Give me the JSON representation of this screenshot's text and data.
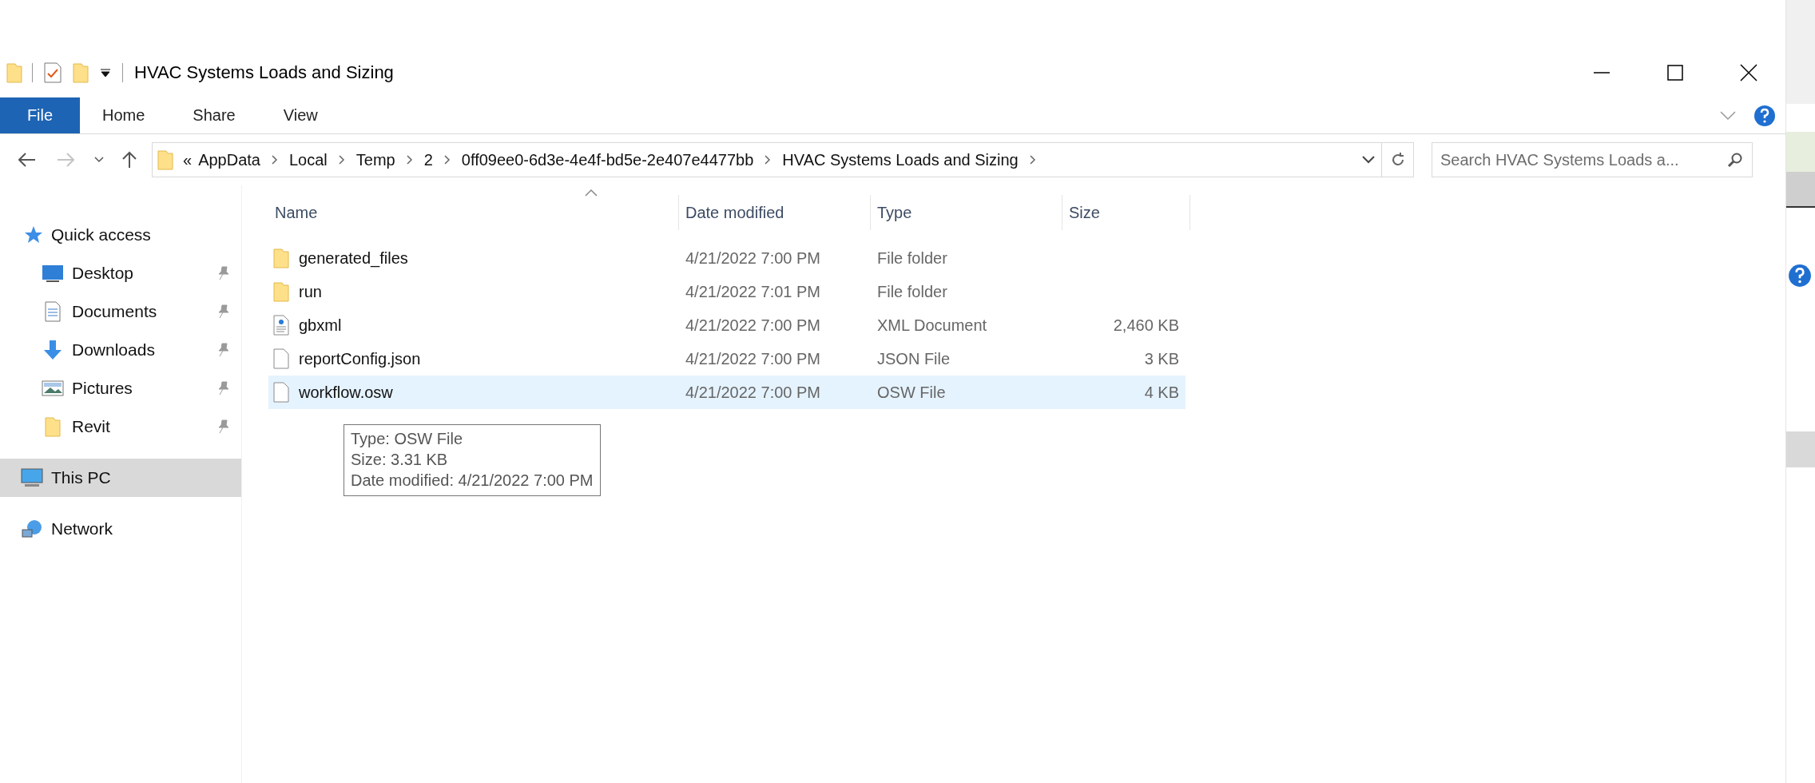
{
  "window": {
    "title": "HVAC Systems Loads and Sizing"
  },
  "ribbon_tabs": [
    {
      "label": "File",
      "kind": "file"
    },
    {
      "label": "Home",
      "kind": "tab"
    },
    {
      "label": "Share",
      "kind": "tab"
    },
    {
      "label": "View",
      "kind": "tab"
    }
  ],
  "address_bar": {
    "overflow": "«",
    "path": [
      "AppData",
      "Local",
      "Temp",
      "2",
      "0ff09ee0-6d3e-4e4f-bd5e-2e407e4477bb",
      "HVAC Systems Loads and Sizing"
    ]
  },
  "search": {
    "placeholder": "Search HVAC Systems Loads a..."
  },
  "sidebar": {
    "items": [
      {
        "label": "Quick access",
        "kind": "star",
        "selected": false,
        "children": [
          {
            "label": "Desktop",
            "kind": "desktop",
            "pinned": true,
            "selected": false
          },
          {
            "label": "Documents",
            "kind": "documents",
            "pinned": true,
            "selected": false
          },
          {
            "label": "Downloads",
            "kind": "downloads",
            "pinned": true,
            "selected": false
          },
          {
            "label": "Pictures",
            "kind": "pictures",
            "pinned": true,
            "selected": false
          },
          {
            "label": "Revit",
            "kind": "folder",
            "pinned": true,
            "selected": false
          }
        ]
      },
      {
        "label": "This PC",
        "kind": "computer",
        "selected": true
      },
      {
        "label": "Network",
        "kind": "network",
        "selected": false
      }
    ]
  },
  "table": {
    "columns": [
      {
        "label": "Name",
        "sorted": true
      },
      {
        "label": "Date modified",
        "sorted": false
      },
      {
        "label": "Type",
        "sorted": false
      },
      {
        "label": "Size",
        "sorted": false
      }
    ],
    "rows": [
      {
        "name": "generated_files",
        "date": "4/21/2022 7:00 PM",
        "type": "File folder",
        "kind": "folder",
        "selected": false
      },
      {
        "name": "run",
        "date": "4/21/2022 7:01 PM",
        "type": "File folder",
        "kind": "folder",
        "selected": false
      },
      {
        "name": "gbxml",
        "date": "4/21/2022 7:00 PM",
        "type": "XML Document",
        "size": "2,460 KB",
        "kind": "xml",
        "selected": false
      },
      {
        "name": "reportConfig.json",
        "date": "4/21/2022 7:00 PM",
        "type": "JSON File",
        "size": "3 KB",
        "kind": "file",
        "selected": false
      },
      {
        "name": "workflow.osw",
        "date": "4/21/2022 7:00 PM",
        "type": "OSW File",
        "size": "4 KB",
        "kind": "file",
        "selected": true
      }
    ]
  },
  "tooltip": {
    "lines": [
      "Type: OSW File",
      "Size: 3.31 KB",
      "Date modified: 4/21/2022 7:00 PM"
    ]
  }
}
